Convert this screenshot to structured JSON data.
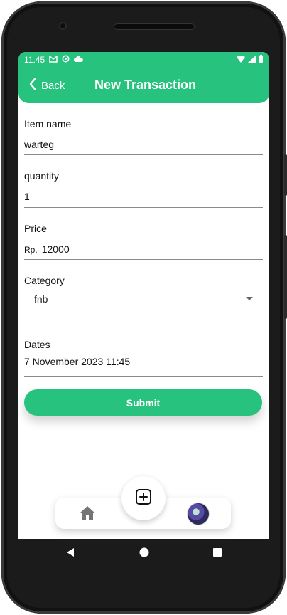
{
  "status_bar": {
    "time": "11.45",
    "icons": [
      "gmail-icon",
      "sync-icon",
      "cloud-icon"
    ],
    "right_icons": [
      "wifi-icon",
      "signal-icon",
      "battery-icon"
    ]
  },
  "app_bar": {
    "back_label": "Back",
    "title": "New Transaction"
  },
  "form": {
    "item_name": {
      "label": "Item name",
      "value": "warteg"
    },
    "quantity": {
      "label": "quantity",
      "value": "1"
    },
    "price": {
      "label": "Price",
      "prefix": "Rp.",
      "value": "12000"
    },
    "category": {
      "label": "Category",
      "value": "fnb"
    },
    "dates": {
      "label": "Dates",
      "value": "7 November 2023 11:45"
    }
  },
  "submit_label": "Submit",
  "bottom_nav": {
    "items": [
      "home-icon",
      "add-icon",
      "profile-avatar"
    ]
  },
  "system_nav": [
    "back-icon",
    "home-circle-icon",
    "recents-icon"
  ],
  "colors": {
    "accent": "#27c27e",
    "text": "#111111",
    "line": "#8a8a8a"
  }
}
